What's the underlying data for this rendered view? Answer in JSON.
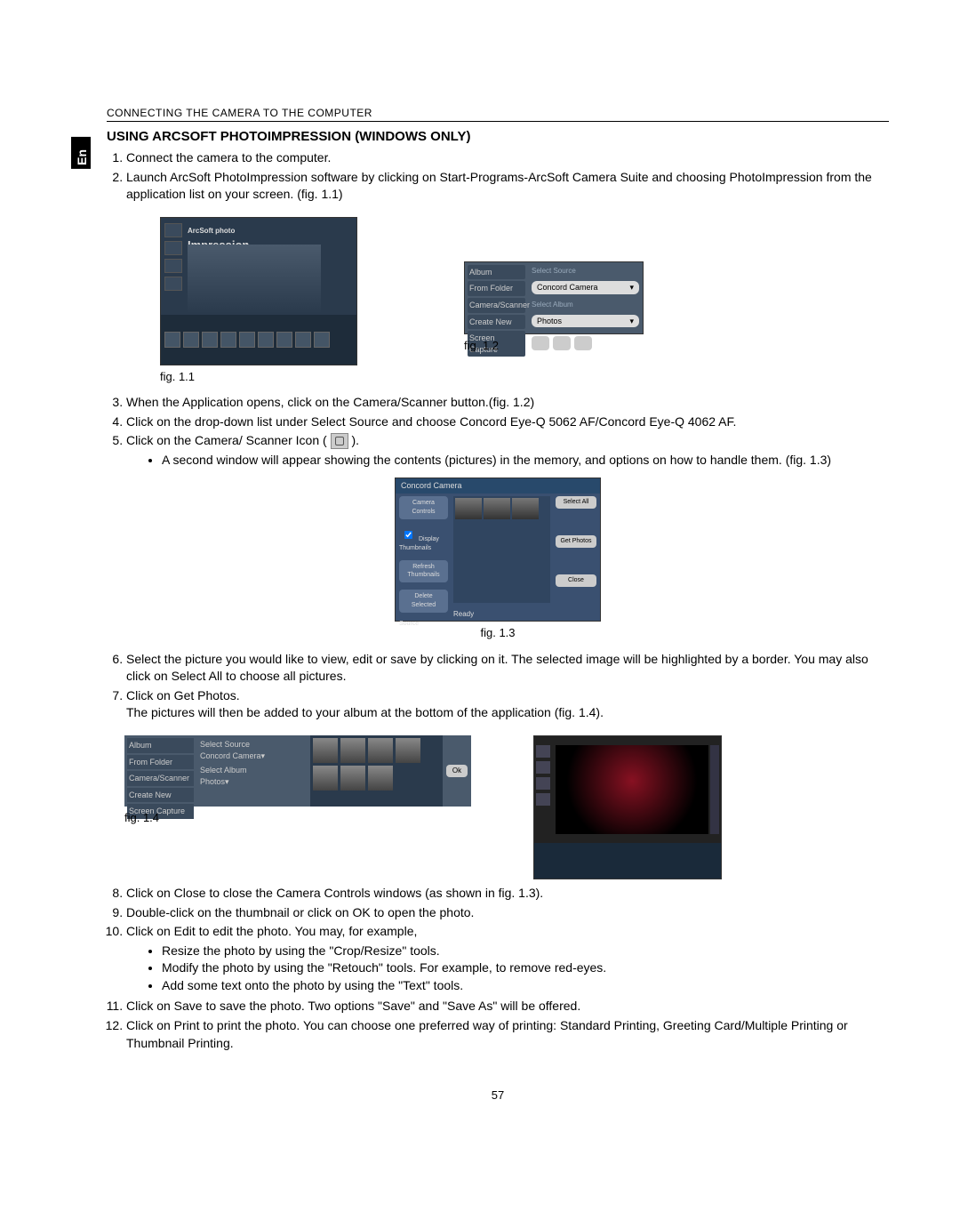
{
  "header": "CONNECTING THE CAMERA TO THE COMPUTER",
  "lang_tab": "En",
  "section_title": "USING ARCSOFT PHOTOIMPRESSION (WINDOWS ONLY)",
  "list1": {
    "i1": "Connect the camera to the computer.",
    "i2": "Launch ArcSoft PhotoImpression software by clicking on Start-Programs-ArcSoft Camera Suite and choosing PhotoImpression from the application list on your screen. (fig. 1.1)"
  },
  "fig11": {
    "title_line1": "ArcSoft photo",
    "title_line2": "Impression",
    "caption": "fig. 1.1"
  },
  "fig12": {
    "sidebar": {
      "album": "Album",
      "from_folder": "From Folder",
      "camera_scanner": "Camera/Scanner",
      "create_new": "Create New",
      "screen_capture": "Screen Capture"
    },
    "select_source_label": "Select Source",
    "select_source_value": "Concord Camera",
    "select_album_label": "Select Album",
    "select_album_value": "Photos",
    "caption": "fig. 1.2"
  },
  "list2": {
    "i3": "When the Application opens, click on the Camera/Scanner button.(fig. 1.2)",
    "i4": "Click on the drop-down list under Select Source and choose Concord Eye-Q 5062 AF/Concord Eye-Q 4062 AF.",
    "i5_prefix": "Click on the Camera/ Scanner Icon (",
    "i5_suffix": ").",
    "i5_sub": "A second window will appear showing the contents (pictures) in the memory, and options on how to handle them.  (fig. 1.3)"
  },
  "fig13": {
    "titlebar": "Concord Camera",
    "camera_controls": "Camera Controls",
    "display_thumbnails": "Display Thumbnails",
    "refresh": "Refresh Thumbnails",
    "delete_selected": "Delete Selected",
    "source_label": "Source",
    "select_all": "Select All",
    "get_photos": "Get Photos",
    "close_btn": "Close",
    "ready": "Ready",
    "caption": "fig. 1.3"
  },
  "list3": {
    "i6": "Select the picture you would like to view, edit or save by clicking on it. The selected image will be highlighted by a border. You may also click on Select All to choose all pictures.",
    "i7_a": "Click on Get Photos.",
    "i7_b": "The pictures will then be added to your album at the bottom of the application (fig. 1.4)."
  },
  "fig14": {
    "sidebar": {
      "album": "Album",
      "from_folder": "From Folder",
      "camera_scanner": "Camera/Scanner",
      "create_new": "Create New",
      "screen_capture": "Screen Capture"
    },
    "select_source_label": "Select Source",
    "select_source_value": "Concord Camera",
    "select_album_label": "Select Album",
    "select_album_value": "Photos",
    "ok": "Ok",
    "caption": "fig. 1.4"
  },
  "list4": {
    "i8": "Click on Close to close the Camera Controls windows (as shown in fig. 1.3).",
    "i9": "Double-click on the thumbnail or click on OK to open the photo.",
    "i10": "Click on Edit to edit the photo.  You may, for example,",
    "i10_a": "Resize the photo by using the \"Crop/Resize\" tools.",
    "i10_b": "Modify the photo by using the \"Retouch\" tools. For  example, to remove red-eyes.",
    "i10_c": "Add some text onto the photo by using the \"Text\" tools.",
    "i11": "Click on Save to save the photo. Two options \"Save\" and \"Save As\" will be offered.",
    "i12": "Click on Print to print the photo. You can choose one preferred way of printing: Standard Printing, Greeting Card/Multiple Printing or Thumbnail Printing."
  },
  "page_number": "57"
}
